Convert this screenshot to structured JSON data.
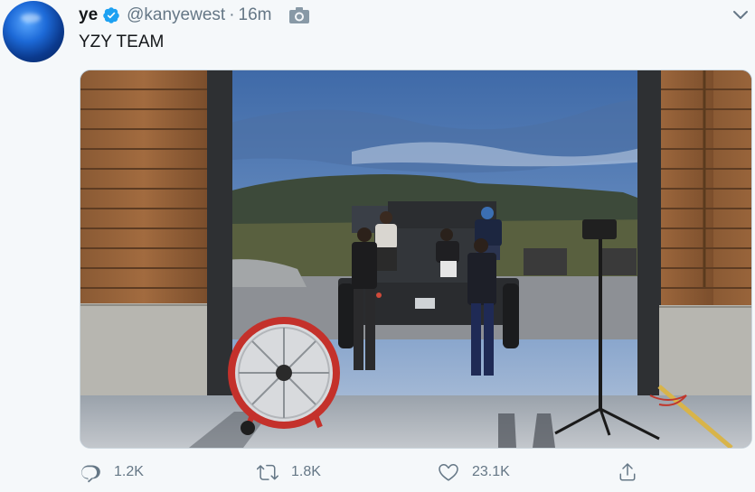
{
  "tweet": {
    "author": {
      "name": "ye",
      "handle": "@kanyewest",
      "verified": true
    },
    "separator": "·",
    "time": "16m",
    "text": "YZY TEAM",
    "media": {
      "type": "photo"
    }
  },
  "actions": {
    "reply_count": "1.2K",
    "retweet_count": "1.8K",
    "like_count": "23.1K"
  },
  "icons": [
    "verified-badge-icon",
    "camera-icon",
    "chevron-down-icon",
    "reply-icon",
    "retweet-icon",
    "like-icon",
    "share-icon"
  ],
  "colors": {
    "background": "#f5f8fa",
    "text": "#14171a",
    "secondary_text": "#657786",
    "verified_blue": "#1da1f2"
  }
}
